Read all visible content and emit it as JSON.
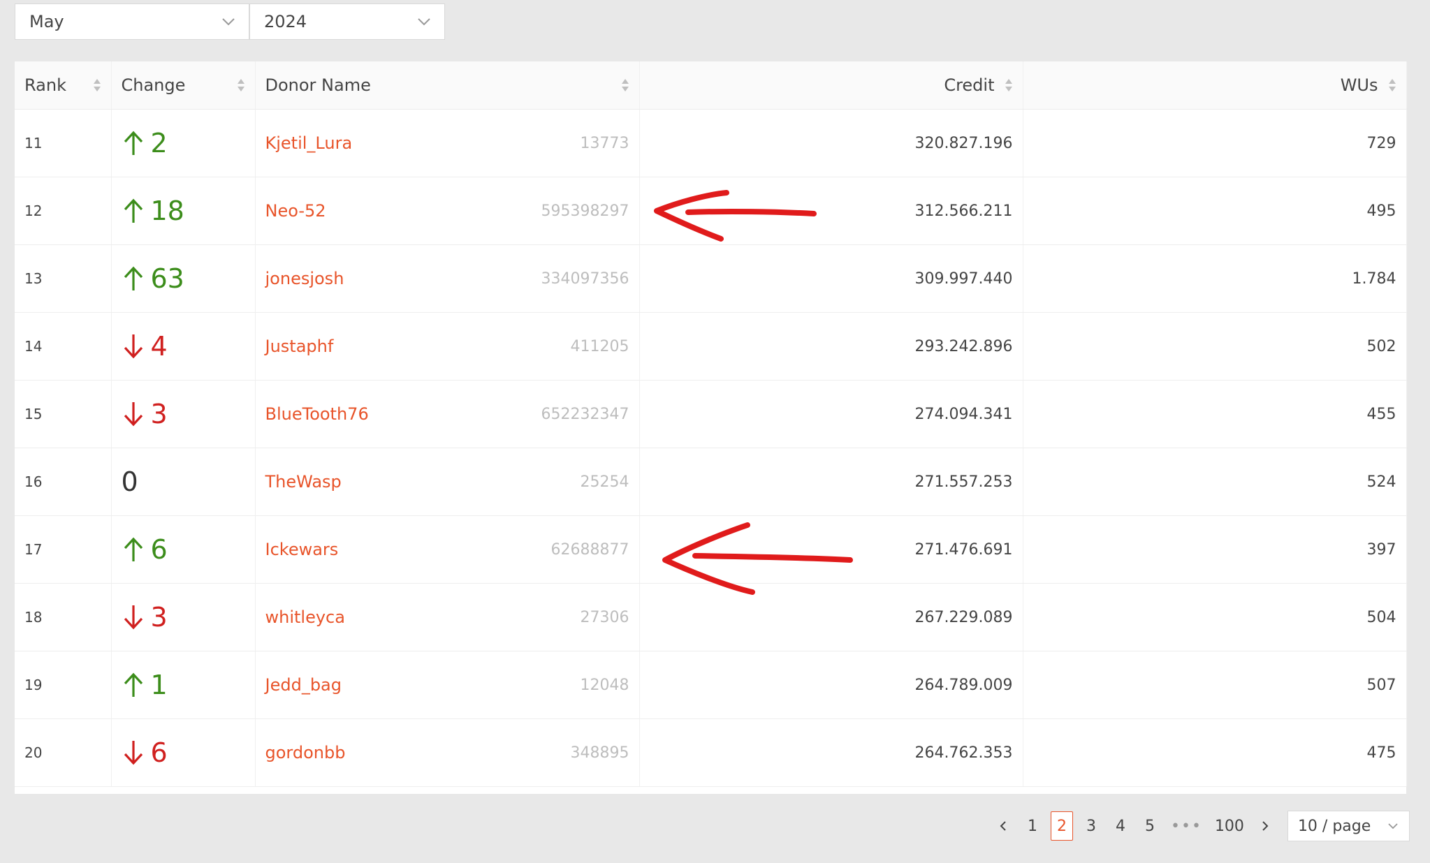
{
  "filters": {
    "month": "May",
    "year": "2024"
  },
  "table": {
    "columns": {
      "rank": "Rank",
      "change": "Change",
      "donor": "Donor Name",
      "credit": "Credit",
      "wus": "WUs"
    },
    "rows": [
      {
        "rank": "11",
        "dir": "up",
        "change": "2",
        "name": "Kjetil_Lura",
        "id": "13773",
        "credit": "320.827.196",
        "wus": "729"
      },
      {
        "rank": "12",
        "dir": "up",
        "change": "18",
        "name": "Neo-52",
        "id": "595398297",
        "credit": "312.566.211",
        "wus": "495"
      },
      {
        "rank": "13",
        "dir": "up",
        "change": "63",
        "name": "jonesjosh",
        "id": "334097356",
        "credit": "309.997.440",
        "wus": "1.784"
      },
      {
        "rank": "14",
        "dir": "down",
        "change": "4",
        "name": "Justaphf",
        "id": "411205",
        "credit": "293.242.896",
        "wus": "502"
      },
      {
        "rank": "15",
        "dir": "down",
        "change": "3",
        "name": "BlueTooth76",
        "id": "652232347",
        "credit": "274.094.341",
        "wus": "455"
      },
      {
        "rank": "16",
        "dir": "zero",
        "change": "0",
        "name": "TheWasp",
        "id": "25254",
        "credit": "271.557.253",
        "wus": "524"
      },
      {
        "rank": "17",
        "dir": "up",
        "change": "6",
        "name": "Ickewars",
        "id": "62688877",
        "credit": "271.476.691",
        "wus": "397"
      },
      {
        "rank": "18",
        "dir": "down",
        "change": "3",
        "name": "whitleyca",
        "id": "27306",
        "credit": "267.229.089",
        "wus": "504"
      },
      {
        "rank": "19",
        "dir": "up",
        "change": "1",
        "name": "Jedd_bag",
        "id": "12048",
        "credit": "264.789.009",
        "wus": "507"
      },
      {
        "rank": "20",
        "dir": "down",
        "change": "6",
        "name": "gordonbb",
        "id": "348895",
        "credit": "264.762.353",
        "wus": "475"
      }
    ]
  },
  "pagination": {
    "pages": [
      "1",
      "2",
      "3",
      "4",
      "5"
    ],
    "current": "2",
    "last": "100",
    "page_size": "10 / page"
  },
  "colors": {
    "up": "#3c8d1b",
    "down": "#d0201f",
    "link": "#e8542a",
    "annotation": "#e01b1b"
  },
  "icons": [
    "chevron-down-icon",
    "sort-icon",
    "arrow-up-icon",
    "arrow-down-icon",
    "chevron-left-icon",
    "chevron-right-icon"
  ]
}
